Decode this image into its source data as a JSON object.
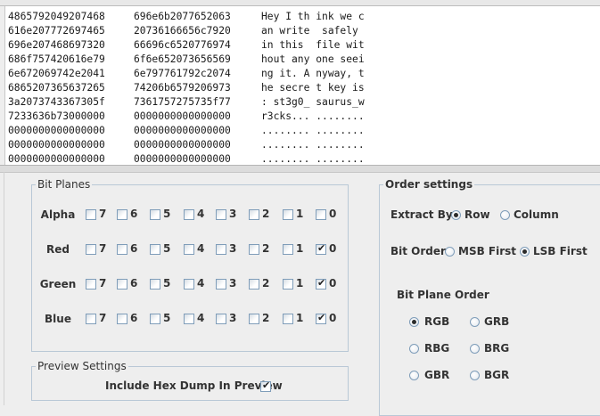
{
  "hex_dump": {
    "rows": [
      [
        "4865792049207468",
        "696e6b2077652063",
        "Hey I th ink we c"
      ],
      [
        "616e207772697465",
        "20736166656c7920",
        "an write  safely "
      ],
      [
        "696e207468697320",
        "66696c6520776974",
        "in this  file wit"
      ],
      [
        "686f757420616e79",
        "6f6e652073656569",
        "hout any one seei"
      ],
      [
        "6e672069742e2041",
        "6e797761792c2074",
        "ng it. A nyway, t"
      ],
      [
        "6865207365637265",
        "74206b6579206973",
        "he secre t key is"
      ],
      [
        "3a2073743367305f",
        "7361757275735f77",
        ": st3g0_ saurus_w"
      ],
      [
        "7233636b73000000",
        "0000000000000000",
        "r3cks... ........"
      ],
      [
        "0000000000000000",
        "0000000000000000",
        "........ ........"
      ],
      [
        "0000000000000000",
        "0000000000000000",
        "........ ........"
      ],
      [
        "0000000000000000",
        "0000000000000000",
        "........ ........"
      ]
    ]
  },
  "bit_planes": {
    "title": "Bit Planes",
    "bits": [
      "7",
      "6",
      "5",
      "4",
      "3",
      "2",
      "1",
      "0"
    ],
    "channels": [
      {
        "name": "Alpha",
        "checked": [
          false,
          false,
          false,
          false,
          false,
          false,
          false,
          false
        ]
      },
      {
        "name": "Red",
        "checked": [
          false,
          false,
          false,
          false,
          false,
          false,
          false,
          true
        ]
      },
      {
        "name": "Green",
        "checked": [
          false,
          false,
          false,
          false,
          false,
          false,
          false,
          true
        ]
      },
      {
        "name": "Blue",
        "checked": [
          false,
          false,
          false,
          false,
          false,
          false,
          false,
          true
        ]
      }
    ]
  },
  "preview_settings": {
    "title": "Preview Settings",
    "include_hex_label": "Include Hex Dump In Preview",
    "include_hex_checked": true
  },
  "order_settings": {
    "title": "Order settings",
    "extract_by_label": "Extract By",
    "extract_by_options": [
      "Row",
      "Column"
    ],
    "extract_by_selected": "Row",
    "bit_order_label": "Bit Order",
    "bit_order_options": [
      "MSB First",
      "LSB First"
    ],
    "bit_order_selected": "LSB First",
    "bit_plane_order_label": "Bit Plane Order",
    "bit_plane_order_options": [
      "RGB",
      "GRB",
      "RBG",
      "BRG",
      "GBR",
      "BGR"
    ],
    "bit_plane_order_selected": "RGB"
  }
}
